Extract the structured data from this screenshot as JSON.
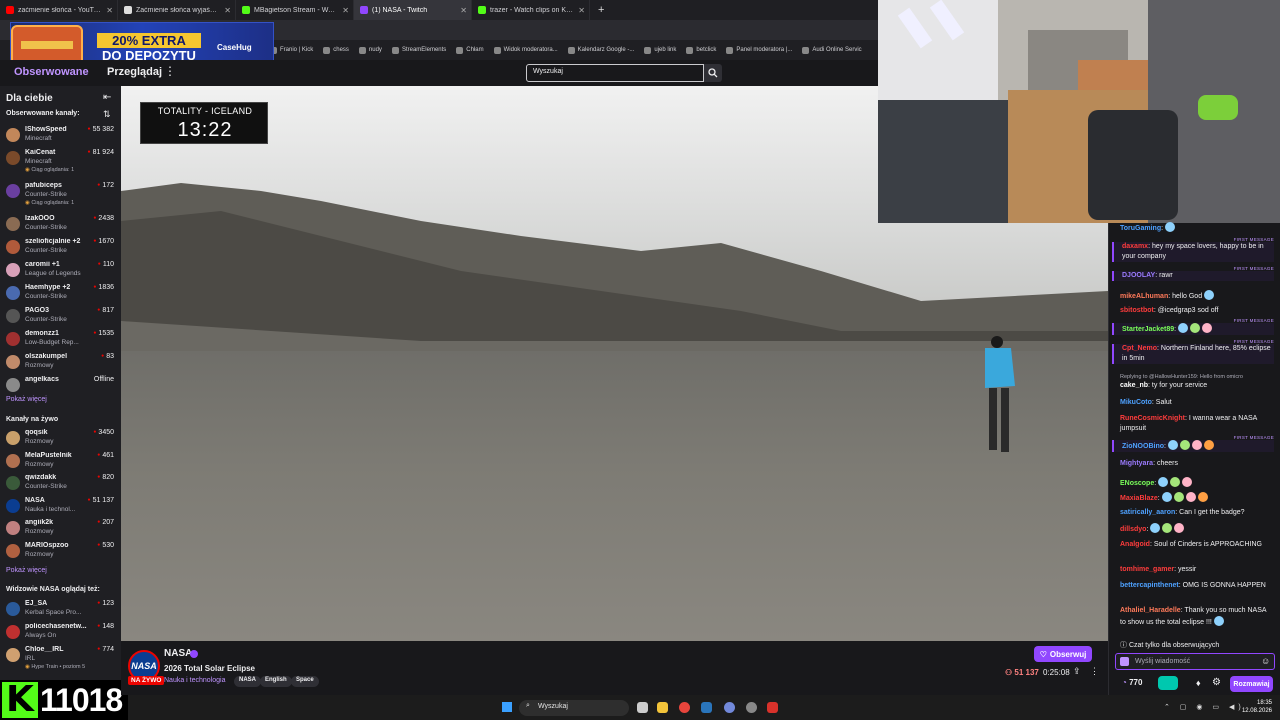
{
  "browser": {
    "tabs": [
      {
        "title": "zaćmienie słońca - YouTube",
        "color": "#ff0000"
      },
      {
        "title": "Zaćmienie słońca wyjaśnione",
        "color": "#dddddd"
      },
      {
        "title": "MBagietson Stream - Watch Liv",
        "color": "#53fc18"
      },
      {
        "title": "(1) NASA - Twitch",
        "color": "#9147ff"
      },
      {
        "title": "trazer - Watch clips on Kick",
        "color": "#53fc18"
      }
    ],
    "bookmarks": [
      "Franio | Kick",
      "chess",
      "nudy",
      "StreamElements",
      "Chłam",
      "Widok moderatora...",
      "Kalendarz Google -...",
      "ujeb link",
      "betclick",
      "Panel moderatora |...",
      "Audi Online Servic"
    ]
  },
  "ad": {
    "promo_line1": "20% EXTRA",
    "promo_line2": "DO DEPOZYTU",
    "brand": "CaseHug"
  },
  "nav": {
    "followed": "Obserwowane",
    "browse": "Przeglądaj",
    "search_placeholder": "Wyszukaj"
  },
  "sidebar": {
    "title": "Dla ciebie",
    "followed_header": "Obserwowane kanały:",
    "followed": [
      {
        "name": "IShowSpeed",
        "game": "Minecraft",
        "viewers": "55 382",
        "color": "#c2875a"
      },
      {
        "name": "KaiCenat",
        "game": "Minecraft",
        "viewers": "81 924",
        "color": "#7a4a2a",
        "sub": "Ciąg oglądania: 1"
      },
      {
        "name": "pafubiceps",
        "game": "Counter-Strike",
        "viewers": "172",
        "color": "#6a3fa0",
        "sub": "Ciąg oglądania: 1"
      },
      {
        "name": "IzakOOO",
        "game": "Counter-Strike",
        "viewers": "2438",
        "color": "#8a6b53"
      },
      {
        "name": "szelioficjalnie +2",
        "game": "Counter-Strike",
        "viewers": "1670",
        "color": "#b05a3b"
      },
      {
        "name": "caromii +1",
        "game": "League of Legends",
        "viewers": "110",
        "color": "#d8a0b8"
      },
      {
        "name": "Haemhype +2",
        "game": "Counter-Strike",
        "viewers": "1836",
        "color": "#4a6ab0"
      },
      {
        "name": "PAGO3",
        "game": "Counter-Strike",
        "viewers": "817",
        "color": "#555555"
      },
      {
        "name": "demonzz1",
        "game": "Low-Budget Rep...",
        "viewers": "1535",
        "color": "#a03030"
      },
      {
        "name": "olszakumpel",
        "game": "Rozmowy",
        "viewers": "83",
        "color": "#c08a6a"
      },
      {
        "name": "angelkacs",
        "game": "",
        "viewers": "Offline",
        "color": "#8a8a8a"
      }
    ],
    "show_more": "Pokaż więcej",
    "live_header": "Kanały na żywo",
    "live": [
      {
        "name": "qoqsik",
        "game": "Rozmowy",
        "viewers": "3450",
        "color": "#c9a06a"
      },
      {
        "name": "MelaPustelnik",
        "game": "Rozmowy",
        "viewers": "461",
        "color": "#b07050"
      },
      {
        "name": "qwizdakk",
        "game": "Counter-Strike",
        "viewers": "820",
        "color": "#3a5a3a"
      },
      {
        "name": "NASA",
        "game": "Nauka i technol...",
        "viewers": "51 137",
        "color": "#0b3d91"
      },
      {
        "name": "angiik2k",
        "game": "Rozmowy",
        "viewers": "207",
        "color": "#c08080"
      },
      {
        "name": "MARIOspzoo",
        "game": "Rozmowy",
        "viewers": "530",
        "color": "#b06040"
      }
    ],
    "show_more_2": "Pokaż więcej",
    "also_header": "Widzowie NASA oglądaj też:",
    "also": [
      {
        "name": "EJ_SA",
        "game": "Kerbal Space Pro...",
        "viewers": "123",
        "color": "#2a5a9a"
      },
      {
        "name": "policechasenetw...",
        "game": "Always On",
        "viewers": "148",
        "color": "#c03030"
      },
      {
        "name": "Chloe__IRL",
        "game": "IRL",
        "viewers": "774",
        "color": "#d0a070",
        "sub": "Hype Train • poziom 5"
      }
    ]
  },
  "kick_overlay": {
    "logo": "K",
    "count": "11018"
  },
  "video": {
    "timer_title": "TOTALITY - ICELAND",
    "timer_time": "13:22"
  },
  "stream": {
    "channel": "NASA",
    "avatar_text": "NASA",
    "live_label": "NA ŻYWO",
    "title": "2026 Total Solar Eclipse",
    "category": "Nauka i technologia",
    "tags": [
      "NASA",
      "English",
      "Space"
    ],
    "follow_label": "Obserwuj",
    "viewers": "51 137",
    "uptime": "0:25:08"
  },
  "chat": {
    "messages": [
      {
        "user": "ToruGaming",
        "color": "#4ea1ff",
        "text": ":",
        "emotes": 1
      },
      {
        "user": "daxamx",
        "color": "#ff3c3c",
        "text": ": hey my space lovers, happy to be in your company",
        "first": true
      },
      {
        "user": "DJOOLAY",
        "color": "#9b7bff",
        "text": ": rawr",
        "first": true
      },
      {
        "user": "mikeALhuman",
        "color": "#ff7a5a",
        "text": ": hello God",
        "emotes": 1
      },
      {
        "user": "sbitostbot",
        "color": "#ff3c3c",
        "text": ": @icedgrap3 sod off"
      },
      {
        "user": "StarterJacket89",
        "color": "#7aff5a",
        "text": ":",
        "emotes": 3,
        "first": true
      },
      {
        "user": "Cpt_Nemo",
        "color": "#ff3c3c",
        "text": ": Northern Finland here, 85% eclipse in 5min",
        "first": true
      },
      {
        "user": "cake_nb",
        "color": "#ffffff",
        "text": ": ty for your service",
        "reply": "Replying to @HallowHunter159: Hello from omicro"
      },
      {
        "user": "MikuCoto",
        "color": "#4ea1ff",
        "text": ": Salut"
      },
      {
        "user": "RuneCosmicKnight",
        "color": "#ff3c3c",
        "text": ": I wanna wear a NASA jumpsuit"
      },
      {
        "user": "ZioNOOBino",
        "color": "#4ea1ff",
        "text": ":",
        "emotes": 4,
        "first": true
      },
      {
        "user": "Mightyara",
        "color": "#9b7bff",
        "text": ": cheers"
      },
      {
        "user": "ENoscope",
        "color": "#7aff5a",
        "text": ":",
        "emotes": 3
      },
      {
        "user": "MaxiaBlaze",
        "color": "#ff3c3c",
        "text": ":",
        "emotes": 4
      },
      {
        "user": "satirically_aaron",
        "color": "#4ea1ff",
        "text": ": Can I get the badge?"
      },
      {
        "user": "dillsdyo",
        "color": "#ff3c3c",
        "text": ":",
        "emotes": 3
      },
      {
        "user": "Analgoid",
        "color": "#ff3c3c",
        "text": ": Soul of Cinders is APPROACHING"
      },
      {
        "user": "tomhime_gamer",
        "color": "#ff3c3c",
        "text": ": yessir"
      },
      {
        "user": "bettercapinthenet",
        "color": "#4ea1ff",
        "text": ": OMG IS GONNA HAPPEN"
      },
      {
        "user": "Athaliel_Haradelle",
        "color": "#ff7a5a",
        "text": ": Thank you so much NASA to show us the total eclipse !!!",
        "emotes": 1
      }
    ],
    "first_label": "FIRST MESSAGE",
    "mode": "Czat tylko dla obserwujących",
    "input_placeholder": "Wyślij wiadomość",
    "points": "770",
    "send_label": "Rozmawiaj"
  },
  "taskbar": {
    "search": "Wyszukaj",
    "time": "18:35",
    "date": "12.08.2026"
  }
}
